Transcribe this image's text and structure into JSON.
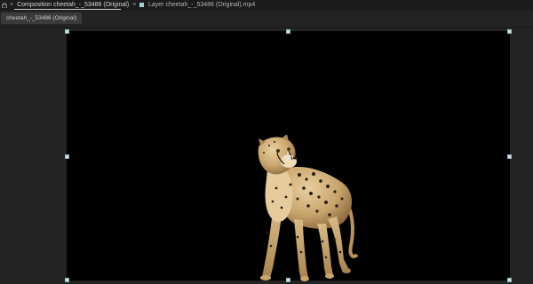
{
  "tabs": {
    "composition_tab": "Composition cheetah_-_53486 (Original)",
    "layer_tab": "Layer cheetah_-_53486 (Original).mp4"
  },
  "viewer": {
    "comp_chip": "cheetah_-_53486 (Original)"
  },
  "colors": {
    "panel_bg": "#232323",
    "canvas_bg": "#000000",
    "layer_swatch": "#9fd3d3",
    "handle": "#cfe3e6"
  },
  "icons": {
    "lock": "lock-icon",
    "close": "close-icon",
    "menu": "hamburger-menu-icon",
    "anchor": "anchor-point-icon"
  }
}
